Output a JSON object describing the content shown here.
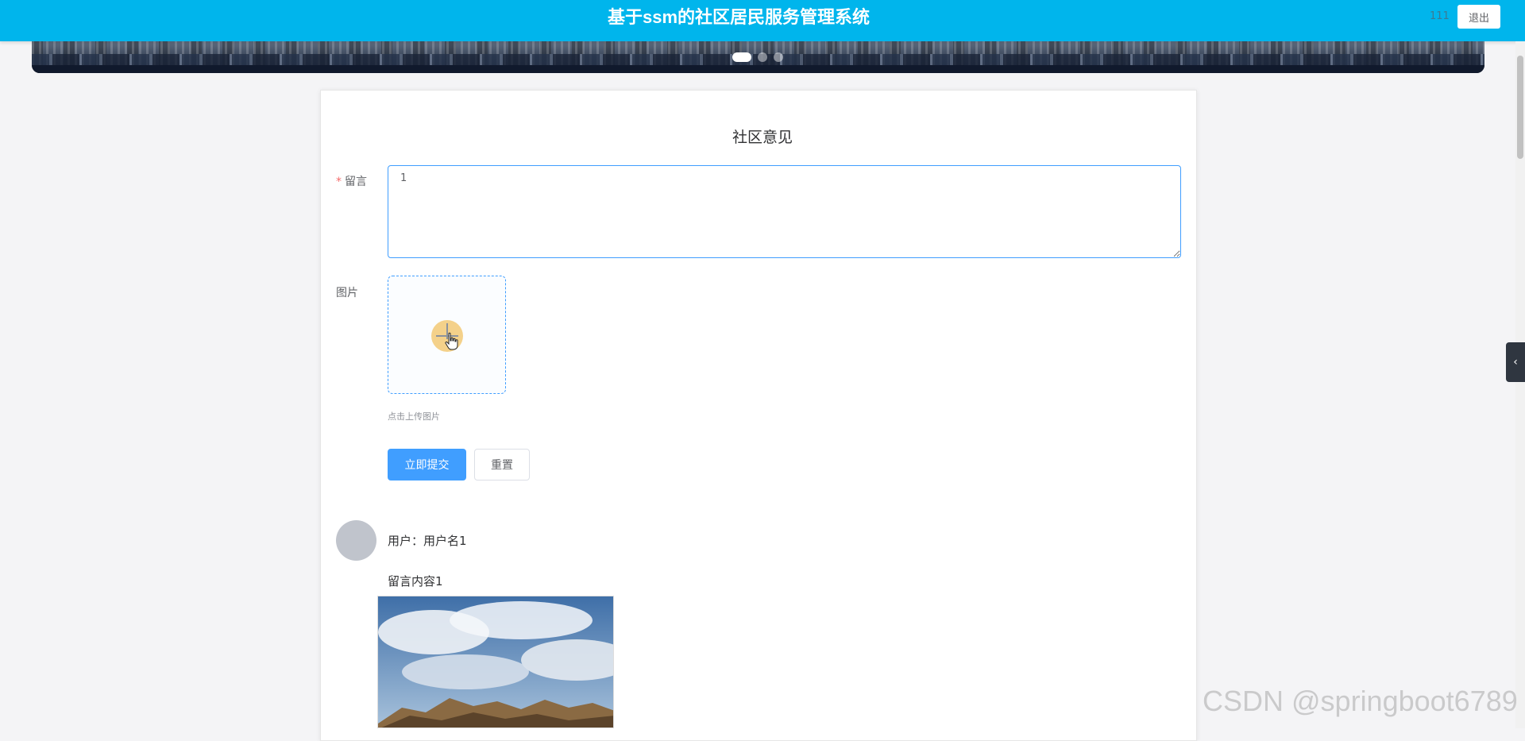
{
  "header": {
    "title": "基于ssm的社区居民服务管理系统",
    "username": "111",
    "logout_label": "退出",
    "bg_color": "#00b5ec"
  },
  "carousel": {
    "indicators": 3,
    "active_index": 0
  },
  "form": {
    "title": "社区意见",
    "message_label": "留言",
    "message_required_mark": "*",
    "message_value": "1",
    "image_label": "图片",
    "upload_icon": "plus-icon",
    "upload_tip": "点击上传图片",
    "submit_label": "立即提交",
    "reset_label": "重置",
    "accent_color": "#409eff"
  },
  "comments": [
    {
      "user_line": "用户：用户名1",
      "content": "留言内容1"
    }
  ],
  "side_handle_icon": "chevron-left-icon",
  "watermark": "CSDN @springboot6789"
}
